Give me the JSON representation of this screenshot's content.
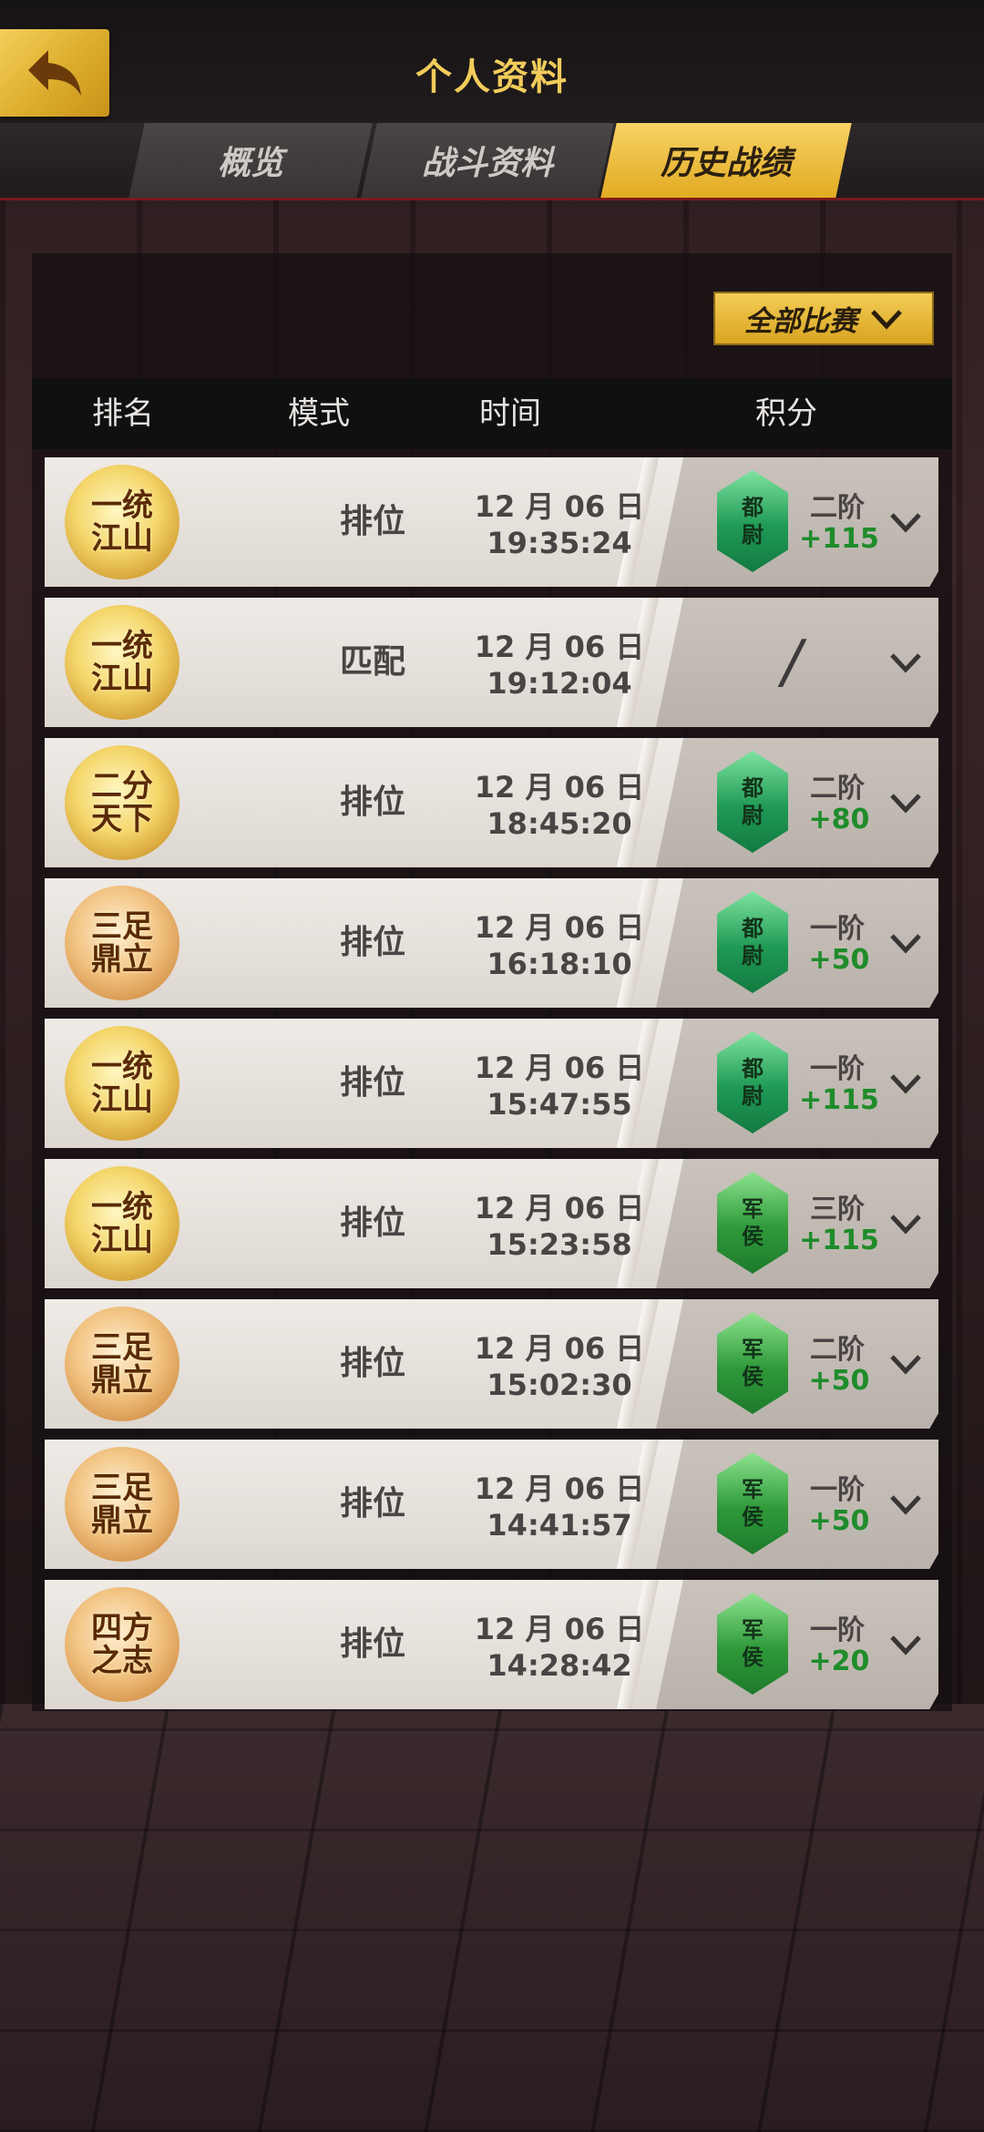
{
  "header": {
    "title": "个人资料"
  },
  "tabs": [
    {
      "label": "概览",
      "active": false
    },
    {
      "label": "战斗资料",
      "active": false
    },
    {
      "label": "历史战绩",
      "active": true
    }
  ],
  "filter": {
    "label": "全部比赛"
  },
  "columns": {
    "rank": "排名",
    "mode": "模式",
    "time": "时间",
    "score": "积分"
  },
  "rows": [
    {
      "rank": "一统江山",
      "mode": "排位",
      "date": "12 月 06 日",
      "clock": "19:35:24",
      "level": "都尉",
      "tier": "二阶",
      "points": "+115"
    },
    {
      "rank": "一统江山",
      "mode": "匹配",
      "date": "12 月 06 日",
      "clock": "19:12:04",
      "level": "",
      "tier": "",
      "points": "",
      "score": "/"
    },
    {
      "rank": "二分天下",
      "mode": "排位",
      "date": "12 月 06 日",
      "clock": "18:45:20",
      "level": "都尉",
      "tier": "二阶",
      "points": "+80"
    },
    {
      "rank": "三足鼎立",
      "mode": "排位",
      "date": "12 月 06 日",
      "clock": "16:18:10",
      "level": "都尉",
      "tier": "一阶",
      "points": "+50"
    },
    {
      "rank": "一统江山",
      "mode": "排位",
      "date": "12 月 06 日",
      "clock": "15:47:55",
      "level": "都尉",
      "tier": "一阶",
      "points": "+115"
    },
    {
      "rank": "一统江山",
      "mode": "排位",
      "date": "12 月 06 日",
      "clock": "15:23:58",
      "level": "军侯",
      "tier": "三阶",
      "points": "+115"
    },
    {
      "rank": "三足鼎立",
      "mode": "排位",
      "date": "12 月 06 日",
      "clock": "15:02:30",
      "level": "军侯",
      "tier": "二阶",
      "points": "+50"
    },
    {
      "rank": "三足鼎立",
      "mode": "排位",
      "date": "12 月 06 日",
      "clock": "14:41:57",
      "level": "军侯",
      "tier": "一阶",
      "points": "+50"
    },
    {
      "rank": "四方之志",
      "mode": "排位",
      "date": "12 月 06 日",
      "clock": "14:28:42",
      "level": "军侯",
      "tier": "一阶",
      "points": "+20"
    }
  ],
  "colors": {
    "gold": "#f2cc5b",
    "points_green": "#1f8c2a",
    "accent_red": "#7a1a1c"
  },
  "icons": {
    "back": "back-arrow-icon",
    "expand": "chevron-down-icon",
    "filter": "chevron-down-icon"
  }
}
